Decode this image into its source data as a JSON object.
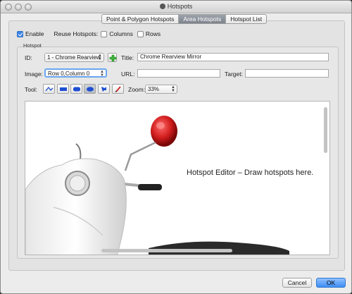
{
  "window": {
    "title": "Hotspots"
  },
  "tabs": [
    {
      "label": "Point & Polygon Hotspots",
      "active": false
    },
    {
      "label": "Area Hotspots",
      "active": true
    },
    {
      "label": "Hotspot List",
      "active": false
    }
  ],
  "options": {
    "enable_label": "Enable",
    "enable_checked": true,
    "reuse_label": "Reuse Hotspots:",
    "columns_label": "Columns",
    "columns_checked": false,
    "rows_label": "Rows",
    "rows_checked": false
  },
  "hotspot": {
    "section_label": "Hotspot",
    "id_label": "ID:",
    "id_value": "1 - Chrome Rearview",
    "title_label": "Title:",
    "title_value": "Chrome Rearview Mirror",
    "image_label": "Image:",
    "image_value": "Row 0,Column 0",
    "url_label": "URL:",
    "url_value": "",
    "target_label": "Target:",
    "target_value": "",
    "tool_label": "Tool:",
    "zoom_label": "Zoom:",
    "zoom_value": "33%"
  },
  "tools": [
    {
      "icon": "polyline-tool-icon",
      "selected": false
    },
    {
      "icon": "rectangle-tool-icon",
      "selected": false
    },
    {
      "icon": "rounded-rectangle-tool-icon",
      "selected": false
    },
    {
      "icon": "ellipse-tool-icon",
      "selected": true
    },
    {
      "icon": "freeform-tool-icon",
      "selected": false
    },
    {
      "icon": "pen-tool-icon",
      "selected": false
    }
  ],
  "canvas": {
    "hint": "Hotspot Editor – Draw hotspots here."
  },
  "buttons": {
    "cancel": "Cancel",
    "ok": "OK"
  },
  "colors": {
    "accent": "#3d8ef5",
    "mirror": "#d21e1e",
    "add_icon": "#3db33a"
  }
}
